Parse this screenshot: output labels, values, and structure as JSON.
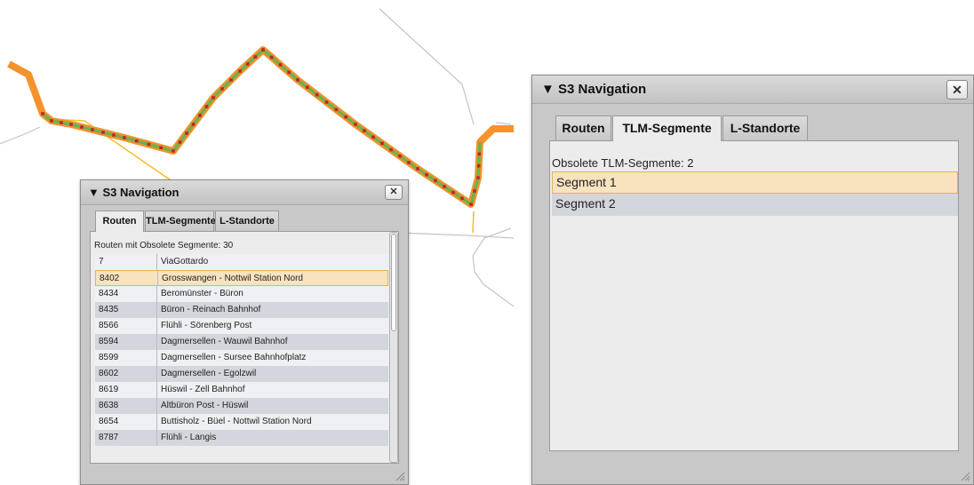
{
  "colors": {
    "route_orange": "#f5922c",
    "route_green": "#6db24a",
    "stop_red": "#cc1f2a",
    "yellow_line": "#f2c230",
    "gray_line": "#c4c4c4",
    "selected_row": "#f8e3bf"
  },
  "small_window": {
    "title": "S3 Navigation",
    "close_icon": "close-icon",
    "close_symbol": "✕",
    "tabs": [
      {
        "label": "Routen",
        "active": true
      },
      {
        "label": "TLM-Segmente",
        "active": false
      },
      {
        "label": "L-Standorte",
        "active": false
      }
    ],
    "list_header": "Routen mit Obsolete Segmente: 30",
    "rows": [
      {
        "id": "7",
        "name": "ViaGottardo"
      },
      {
        "id": "8402",
        "name": "Grosswangen - Nottwil Station Nord",
        "selected": true
      },
      {
        "id": "8434",
        "name": "Beromünster - Büron"
      },
      {
        "id": "8435",
        "name": "Büron - Reinach Bahnhof"
      },
      {
        "id": "8566",
        "name": "Flühli - Sörenberg Post"
      },
      {
        "id": "8594",
        "name": "Dagmersellen - Wauwil Bahnhof"
      },
      {
        "id": "8599",
        "name": "Dagmersellen - Sursee Bahnhofplatz"
      },
      {
        "id": "8602",
        "name": "Dagmersellen - Egolzwil"
      },
      {
        "id": "8619",
        "name": "Hüswil - Zell Bahnhof"
      },
      {
        "id": "8638",
        "name": "Altbüron Post - Hüswil"
      },
      {
        "id": "8654",
        "name": "Buttisholz - Büel - Nottwil Station Nord"
      },
      {
        "id": "8787",
        "name": "Flühli - Langis"
      }
    ]
  },
  "large_window": {
    "title": "S3 Navigation",
    "close_icon": "close-icon",
    "close_symbol": "✕",
    "tabs": [
      {
        "label": "Routen",
        "active": false
      },
      {
        "label": "TLM-Segmente",
        "active": true
      },
      {
        "label": "L-Standorte",
        "active": false
      }
    ],
    "list_header": "Obsolete TLM-Segmente: 2",
    "rows": [
      {
        "name": "Segment 1",
        "selected": true
      },
      {
        "name": "Segment 2"
      }
    ]
  }
}
